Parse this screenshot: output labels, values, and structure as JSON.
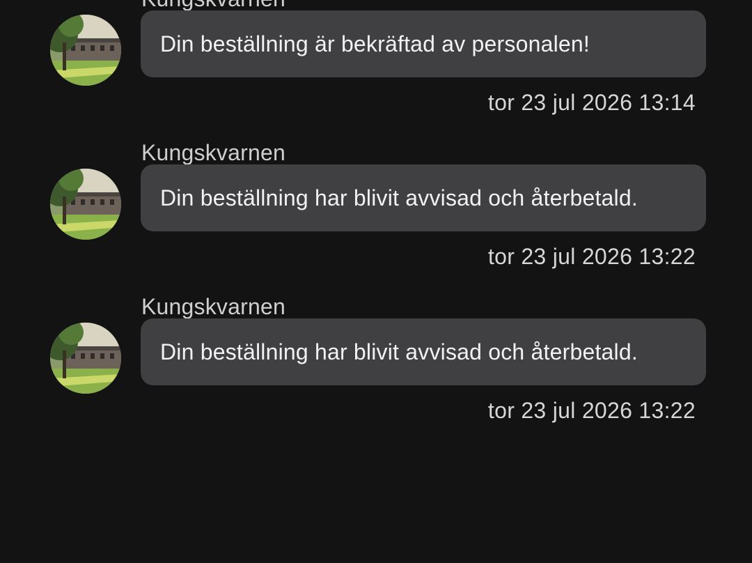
{
  "messages": [
    {
      "sender": "Kungskvarnen",
      "text": "Din beställning är bekräftad av personalen!",
      "timestamp": "tor 23 jul 2026 13:14"
    },
    {
      "sender": "Kungskvarnen",
      "text": "Din beställning har blivit avvisad och återbetald.",
      "timestamp": "tor 23 jul 2026 13:22"
    },
    {
      "sender": "Kungskvarnen",
      "text": "Din beställning har blivit avvisad och återbetald.",
      "timestamp": "tor 23 jul 2026 13:22"
    }
  ],
  "colors": {
    "background": "#131313",
    "bubble": "#404042",
    "text": "#f2f2f2",
    "meta_text": "#d6d6d6"
  },
  "icons": {
    "avatar": "restaurant-building-photo-avatar"
  }
}
